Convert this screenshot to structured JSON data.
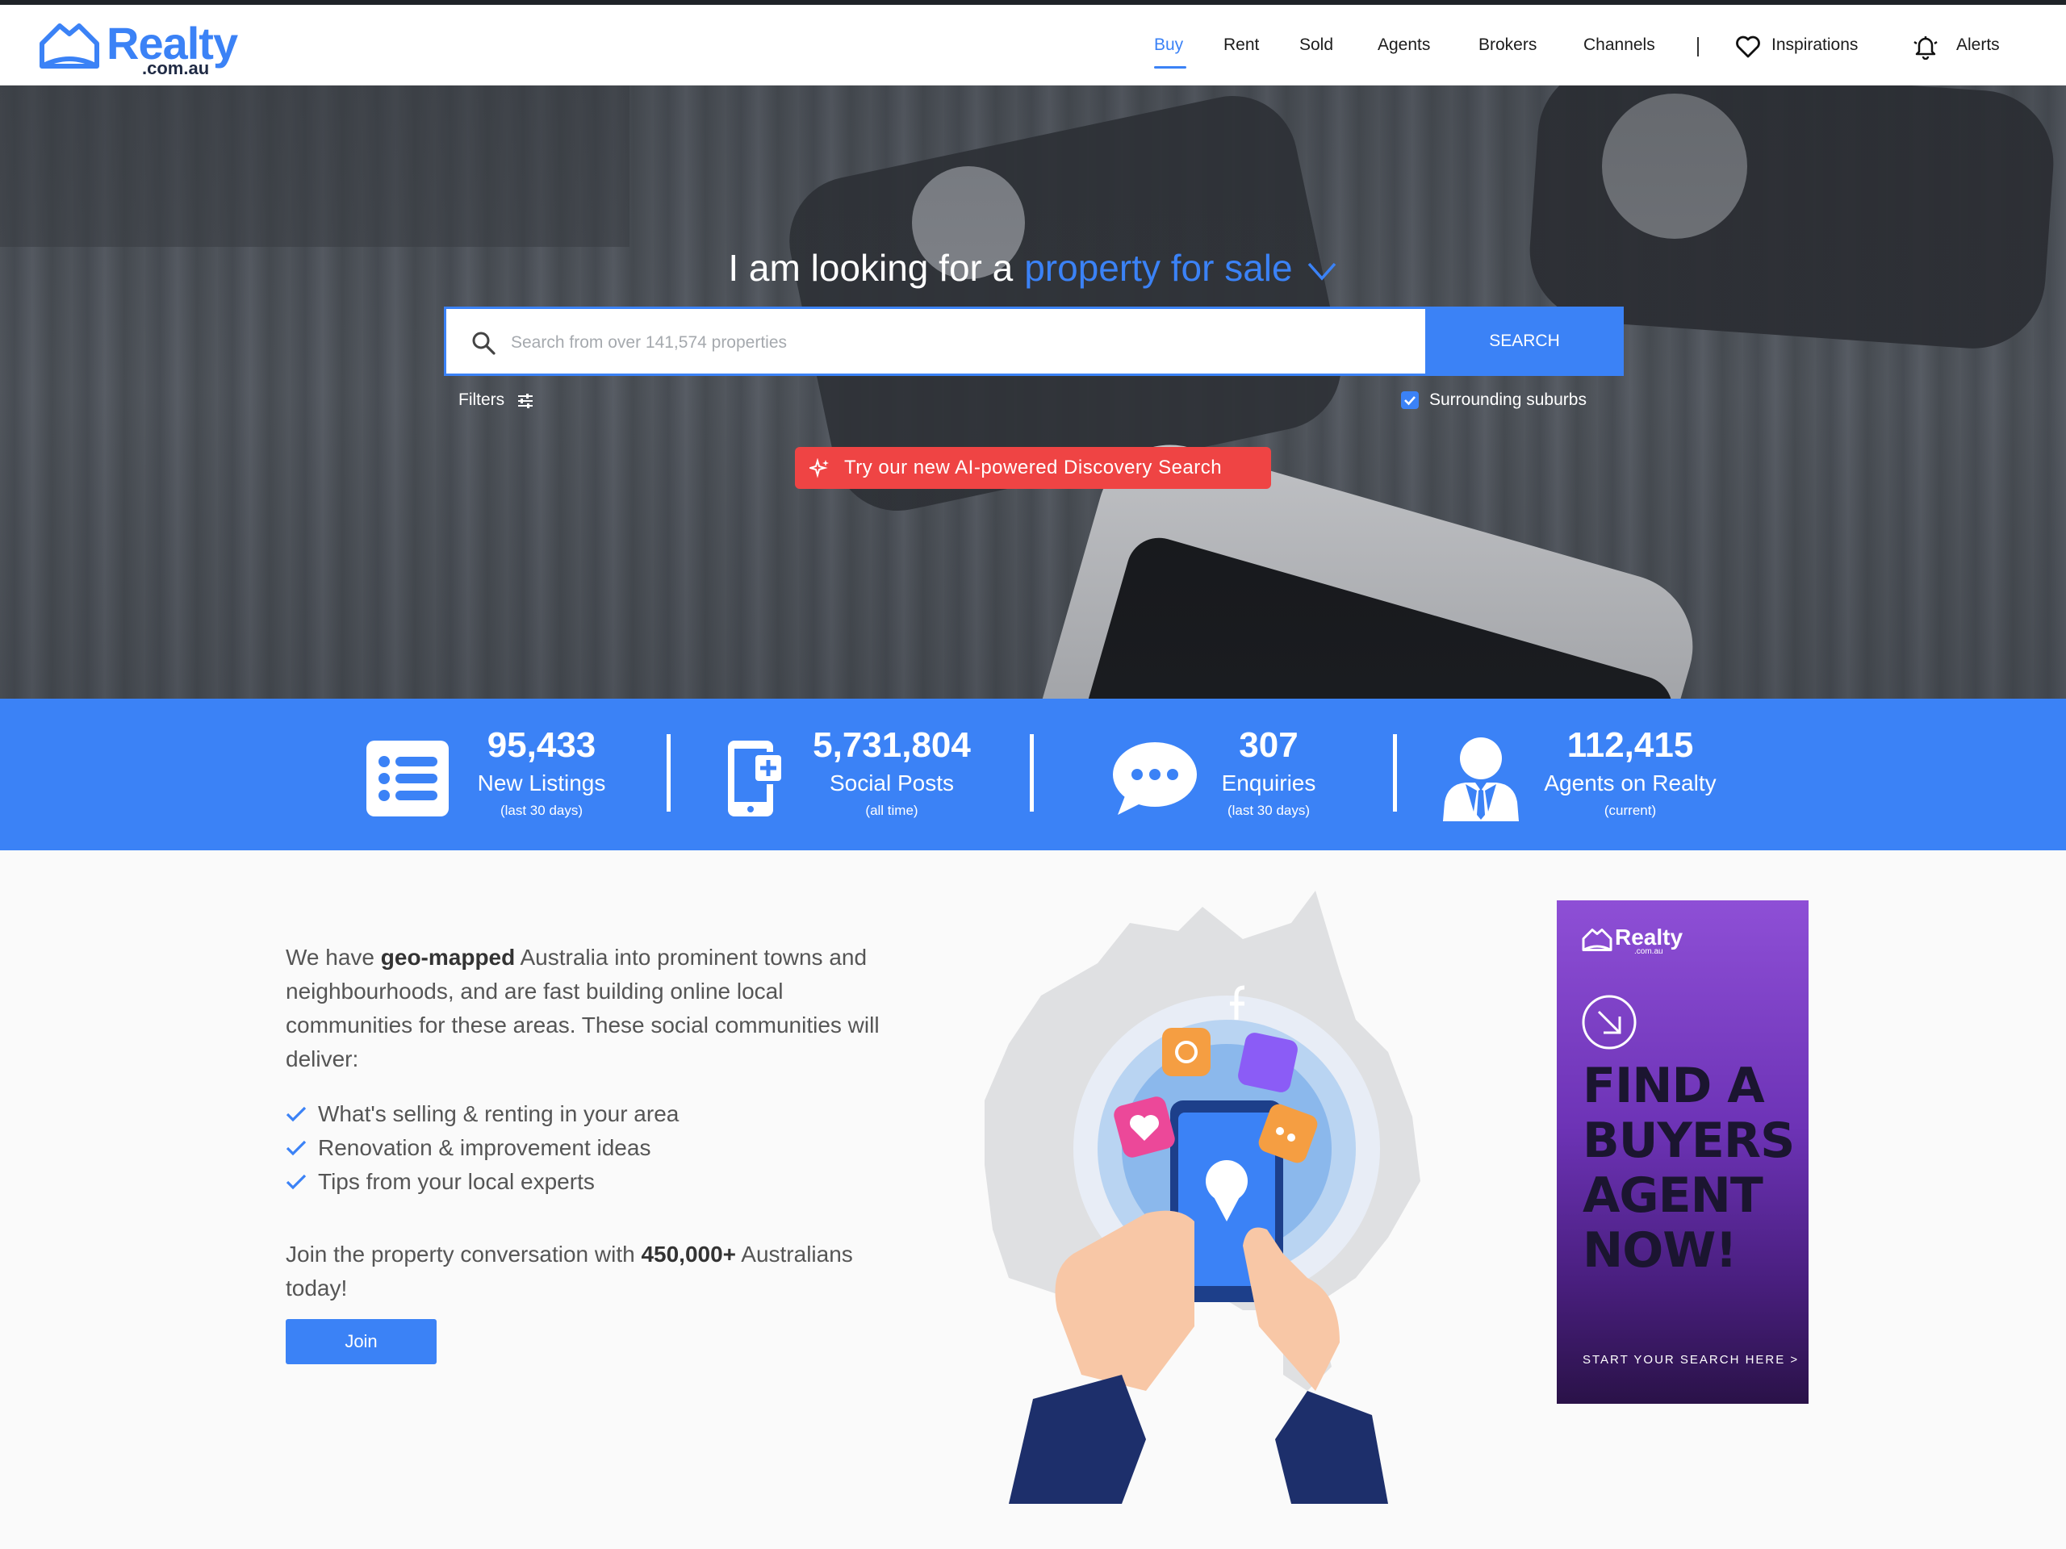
{
  "header": {
    "logo_word": "Realty",
    "logo_sub": ".com.au",
    "nav": [
      "Buy",
      "Rent",
      "Sold",
      "Agents",
      "Brokers",
      "Channels"
    ],
    "active_nav": "Buy",
    "inspirations_label": "Inspirations",
    "alerts_label": "Alerts"
  },
  "hero": {
    "title_prefix": "I am looking for a",
    "title_selection": "property for sale",
    "search_placeholder": "Search from over 141,574 properties",
    "search_button": "SEARCH",
    "filters_label": "Filters",
    "surrounding_label": "Surrounding suburbs",
    "surrounding_checked": true,
    "ai_button": "Try our new AI-powered Discovery Search"
  },
  "stats": [
    {
      "icon": "list-icon",
      "value": "95,433",
      "label": "New Listings",
      "sub": "(last 30 days)"
    },
    {
      "icon": "mobile-post-icon",
      "value": "5,731,804",
      "label": "Social Posts",
      "sub": "(all time)"
    },
    {
      "icon": "chat-bubble-icon",
      "value": "307",
      "label": "Enquiries",
      "sub": "(last 30 days)"
    },
    {
      "icon": "agent-icon",
      "value": "112,415",
      "label": "Agents on Realty",
      "sub": "(current)"
    }
  ],
  "content": {
    "intro_1": "We have ",
    "intro_bold": "geo-mapped",
    "intro_2": " Australia into prominent towns and neighbourhoods, and are fast building online local communities for these areas. These social communities will deliver:",
    "benefits": [
      "What's selling & renting in your area",
      "Renovation & improvement ideas",
      "Tips from your local experts"
    ],
    "join_1": "Join the property conversation with ",
    "join_bold": "450,000+",
    "join_2": " Australians today!",
    "join_button": "Join"
  },
  "ad": {
    "logo_word": "Realty",
    "logo_sub": ".com.au",
    "headline": "FIND A BUYERS AGENT NOW!",
    "cta": "START YOUR SEARCH HERE >"
  },
  "colors": {
    "brand": "#3b82f6",
    "ai_red": "#ef4444",
    "ad_purple": "#6d33b6"
  }
}
